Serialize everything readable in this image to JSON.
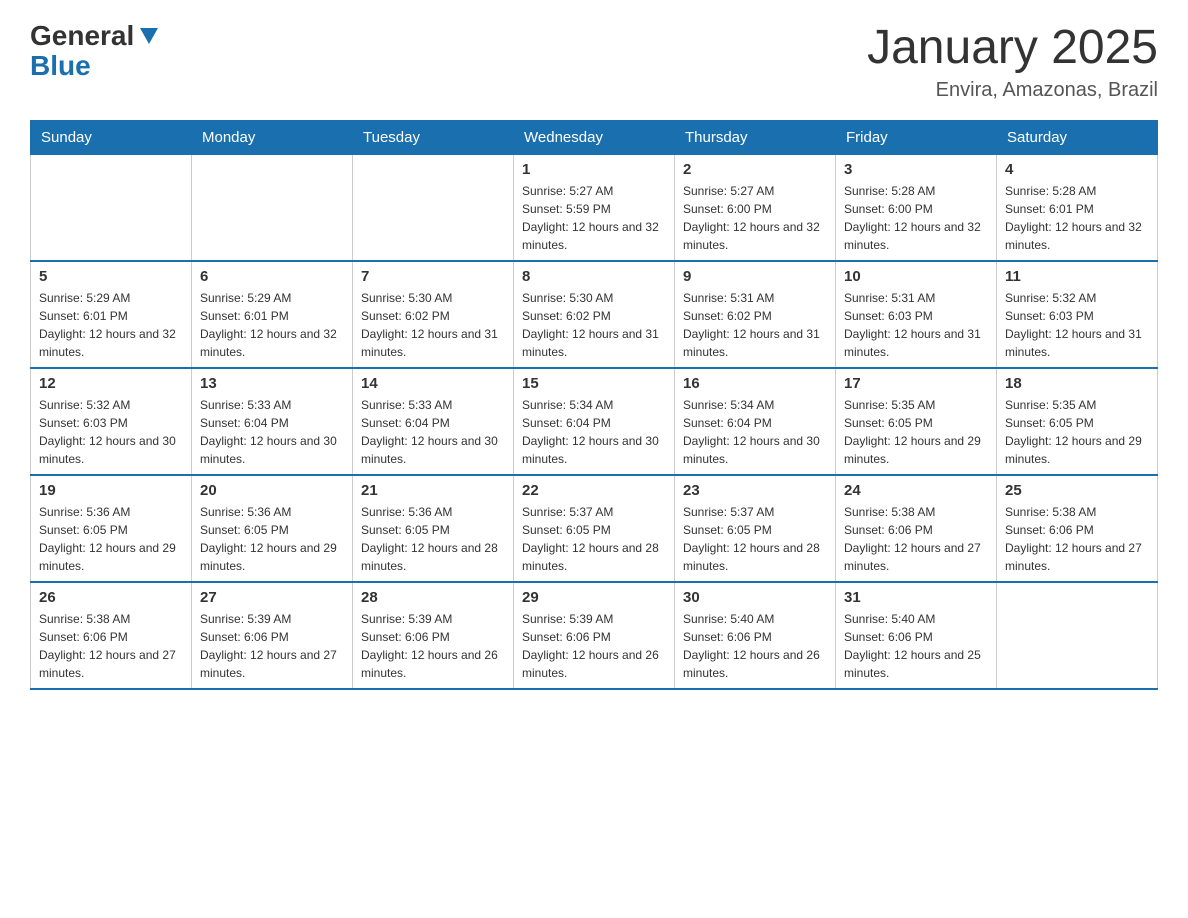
{
  "header": {
    "logo_general": "General",
    "logo_blue": "Blue",
    "title": "January 2025",
    "subtitle": "Envira, Amazonas, Brazil"
  },
  "days_of_week": [
    "Sunday",
    "Monday",
    "Tuesday",
    "Wednesday",
    "Thursday",
    "Friday",
    "Saturday"
  ],
  "weeks": [
    [
      {
        "day": "",
        "sunrise": "",
        "sunset": "",
        "daylight": ""
      },
      {
        "day": "",
        "sunrise": "",
        "sunset": "",
        "daylight": ""
      },
      {
        "day": "",
        "sunrise": "",
        "sunset": "",
        "daylight": ""
      },
      {
        "day": "1",
        "sunrise": "Sunrise: 5:27 AM",
        "sunset": "Sunset: 5:59 PM",
        "daylight": "Daylight: 12 hours and 32 minutes."
      },
      {
        "day": "2",
        "sunrise": "Sunrise: 5:27 AM",
        "sunset": "Sunset: 6:00 PM",
        "daylight": "Daylight: 12 hours and 32 minutes."
      },
      {
        "day": "3",
        "sunrise": "Sunrise: 5:28 AM",
        "sunset": "Sunset: 6:00 PM",
        "daylight": "Daylight: 12 hours and 32 minutes."
      },
      {
        "day": "4",
        "sunrise": "Sunrise: 5:28 AM",
        "sunset": "Sunset: 6:01 PM",
        "daylight": "Daylight: 12 hours and 32 minutes."
      }
    ],
    [
      {
        "day": "5",
        "sunrise": "Sunrise: 5:29 AM",
        "sunset": "Sunset: 6:01 PM",
        "daylight": "Daylight: 12 hours and 32 minutes."
      },
      {
        "day": "6",
        "sunrise": "Sunrise: 5:29 AM",
        "sunset": "Sunset: 6:01 PM",
        "daylight": "Daylight: 12 hours and 32 minutes."
      },
      {
        "day": "7",
        "sunrise": "Sunrise: 5:30 AM",
        "sunset": "Sunset: 6:02 PM",
        "daylight": "Daylight: 12 hours and 31 minutes."
      },
      {
        "day": "8",
        "sunrise": "Sunrise: 5:30 AM",
        "sunset": "Sunset: 6:02 PM",
        "daylight": "Daylight: 12 hours and 31 minutes."
      },
      {
        "day": "9",
        "sunrise": "Sunrise: 5:31 AM",
        "sunset": "Sunset: 6:02 PM",
        "daylight": "Daylight: 12 hours and 31 minutes."
      },
      {
        "day": "10",
        "sunrise": "Sunrise: 5:31 AM",
        "sunset": "Sunset: 6:03 PM",
        "daylight": "Daylight: 12 hours and 31 minutes."
      },
      {
        "day": "11",
        "sunrise": "Sunrise: 5:32 AM",
        "sunset": "Sunset: 6:03 PM",
        "daylight": "Daylight: 12 hours and 31 minutes."
      }
    ],
    [
      {
        "day": "12",
        "sunrise": "Sunrise: 5:32 AM",
        "sunset": "Sunset: 6:03 PM",
        "daylight": "Daylight: 12 hours and 30 minutes."
      },
      {
        "day": "13",
        "sunrise": "Sunrise: 5:33 AM",
        "sunset": "Sunset: 6:04 PM",
        "daylight": "Daylight: 12 hours and 30 minutes."
      },
      {
        "day": "14",
        "sunrise": "Sunrise: 5:33 AM",
        "sunset": "Sunset: 6:04 PM",
        "daylight": "Daylight: 12 hours and 30 minutes."
      },
      {
        "day": "15",
        "sunrise": "Sunrise: 5:34 AM",
        "sunset": "Sunset: 6:04 PM",
        "daylight": "Daylight: 12 hours and 30 minutes."
      },
      {
        "day": "16",
        "sunrise": "Sunrise: 5:34 AM",
        "sunset": "Sunset: 6:04 PM",
        "daylight": "Daylight: 12 hours and 30 minutes."
      },
      {
        "day": "17",
        "sunrise": "Sunrise: 5:35 AM",
        "sunset": "Sunset: 6:05 PM",
        "daylight": "Daylight: 12 hours and 29 minutes."
      },
      {
        "day": "18",
        "sunrise": "Sunrise: 5:35 AM",
        "sunset": "Sunset: 6:05 PM",
        "daylight": "Daylight: 12 hours and 29 minutes."
      }
    ],
    [
      {
        "day": "19",
        "sunrise": "Sunrise: 5:36 AM",
        "sunset": "Sunset: 6:05 PM",
        "daylight": "Daylight: 12 hours and 29 minutes."
      },
      {
        "day": "20",
        "sunrise": "Sunrise: 5:36 AM",
        "sunset": "Sunset: 6:05 PM",
        "daylight": "Daylight: 12 hours and 29 minutes."
      },
      {
        "day": "21",
        "sunrise": "Sunrise: 5:36 AM",
        "sunset": "Sunset: 6:05 PM",
        "daylight": "Daylight: 12 hours and 28 minutes."
      },
      {
        "day": "22",
        "sunrise": "Sunrise: 5:37 AM",
        "sunset": "Sunset: 6:05 PM",
        "daylight": "Daylight: 12 hours and 28 minutes."
      },
      {
        "day": "23",
        "sunrise": "Sunrise: 5:37 AM",
        "sunset": "Sunset: 6:05 PM",
        "daylight": "Daylight: 12 hours and 28 minutes."
      },
      {
        "day": "24",
        "sunrise": "Sunrise: 5:38 AM",
        "sunset": "Sunset: 6:06 PM",
        "daylight": "Daylight: 12 hours and 27 minutes."
      },
      {
        "day": "25",
        "sunrise": "Sunrise: 5:38 AM",
        "sunset": "Sunset: 6:06 PM",
        "daylight": "Daylight: 12 hours and 27 minutes."
      }
    ],
    [
      {
        "day": "26",
        "sunrise": "Sunrise: 5:38 AM",
        "sunset": "Sunset: 6:06 PM",
        "daylight": "Daylight: 12 hours and 27 minutes."
      },
      {
        "day": "27",
        "sunrise": "Sunrise: 5:39 AM",
        "sunset": "Sunset: 6:06 PM",
        "daylight": "Daylight: 12 hours and 27 minutes."
      },
      {
        "day": "28",
        "sunrise": "Sunrise: 5:39 AM",
        "sunset": "Sunset: 6:06 PM",
        "daylight": "Daylight: 12 hours and 26 minutes."
      },
      {
        "day": "29",
        "sunrise": "Sunrise: 5:39 AM",
        "sunset": "Sunset: 6:06 PM",
        "daylight": "Daylight: 12 hours and 26 minutes."
      },
      {
        "day": "30",
        "sunrise": "Sunrise: 5:40 AM",
        "sunset": "Sunset: 6:06 PM",
        "daylight": "Daylight: 12 hours and 26 minutes."
      },
      {
        "day": "31",
        "sunrise": "Sunrise: 5:40 AM",
        "sunset": "Sunset: 6:06 PM",
        "daylight": "Daylight: 12 hours and 25 minutes."
      },
      {
        "day": "",
        "sunrise": "",
        "sunset": "",
        "daylight": ""
      }
    ]
  ]
}
